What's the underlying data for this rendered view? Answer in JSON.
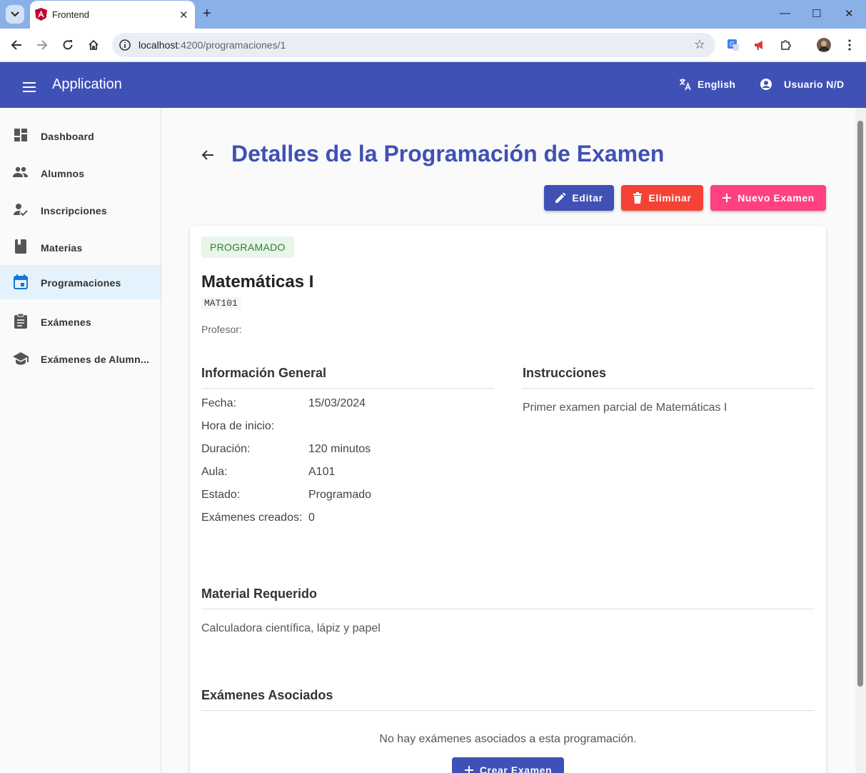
{
  "browser": {
    "tab_title": "Frontend",
    "url_host": "localhost",
    "url_rest": ":4200/programaciones/1"
  },
  "appbar": {
    "title": "Application",
    "language": "English",
    "user": "Usuario N/D"
  },
  "sidebar": {
    "items": [
      {
        "label": "Dashboard",
        "icon": "dashboard-icon"
      },
      {
        "label": "Alumnos",
        "icon": "people-icon"
      },
      {
        "label": "Inscripciones",
        "icon": "how-to-reg-icon"
      },
      {
        "label": "Materias",
        "icon": "book-icon"
      },
      {
        "label": "Programaciones",
        "icon": "calendar-icon",
        "active": true
      },
      {
        "label": "Exámenes",
        "icon": "assignment-icon"
      },
      {
        "label": "Exámenes de Alumn...",
        "icon": "school-icon"
      }
    ]
  },
  "page": {
    "title": "Detalles de la Programación de Examen",
    "actions": {
      "edit": "Editar",
      "delete": "Eliminar",
      "new_exam": "Nuevo Examen"
    },
    "status_badge": "PROGRAMADO",
    "subject": "Matemáticas I",
    "code": "MAT101",
    "professor_label": "Profesor:",
    "general": {
      "heading": "Información General",
      "rows": [
        {
          "key": "Fecha:",
          "value": "15/03/2024"
        },
        {
          "key": "Hora de inicio:",
          "value": ""
        },
        {
          "key": "Duración:",
          "value": "120 minutos"
        },
        {
          "key": "Aula:",
          "value": "A101"
        },
        {
          "key": "Estado:",
          "value": "Programado"
        },
        {
          "key": "Exámenes creados:",
          "value": "0"
        }
      ]
    },
    "instructions": {
      "heading": "Instrucciones",
      "text": "Primer examen parcial de Matemáticas I"
    },
    "material": {
      "heading": "Material Requerido",
      "text": "Calculadora científica, lápiz y papel"
    },
    "exams": {
      "heading": "Exámenes Asociados",
      "empty": "No hay exámenes asociados a esta programación.",
      "create": "Crear Examen"
    }
  },
  "colors": {
    "primary": "#3f51b5",
    "warn": "#f44336",
    "accent": "#ff4081",
    "badge_bg": "#e8f5e9",
    "badge_text": "#2e7d32"
  }
}
